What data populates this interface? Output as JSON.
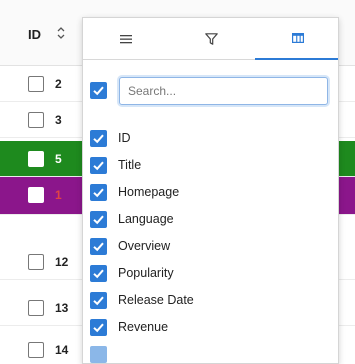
{
  "grid": {
    "header": {
      "id_label": "ID"
    },
    "rows": [
      {
        "id": "2",
        "style": "white"
      },
      {
        "id": "3",
        "style": "white"
      },
      {
        "id": "5",
        "style": "green"
      },
      {
        "id": "1",
        "style": "purple"
      },
      {
        "id": "12",
        "style": "white"
      },
      {
        "id": "13",
        "style": "white"
      },
      {
        "id": "14",
        "style": "white"
      }
    ]
  },
  "column_menu": {
    "tabs": [
      {
        "name": "general-menu",
        "icon": "hamburger-icon",
        "active": false
      },
      {
        "name": "filter",
        "icon": "filter-icon",
        "active": false
      },
      {
        "name": "columns",
        "icon": "columns-icon",
        "active": true
      }
    ],
    "search_placeholder": "Search...",
    "columns": [
      {
        "label": "ID",
        "checked": true
      },
      {
        "label": "Title",
        "checked": true
      },
      {
        "label": "Homepage",
        "checked": true
      },
      {
        "label": "Language",
        "checked": true
      },
      {
        "label": "Overview",
        "checked": true
      },
      {
        "label": "Popularity",
        "checked": true
      },
      {
        "label": "Release Date",
        "checked": true
      },
      {
        "label": "Revenue",
        "checked": true
      }
    ]
  },
  "colors": {
    "accent": "#2c7bd6",
    "row_green": "#1e8a1e",
    "row_purple": "#8b168b"
  }
}
